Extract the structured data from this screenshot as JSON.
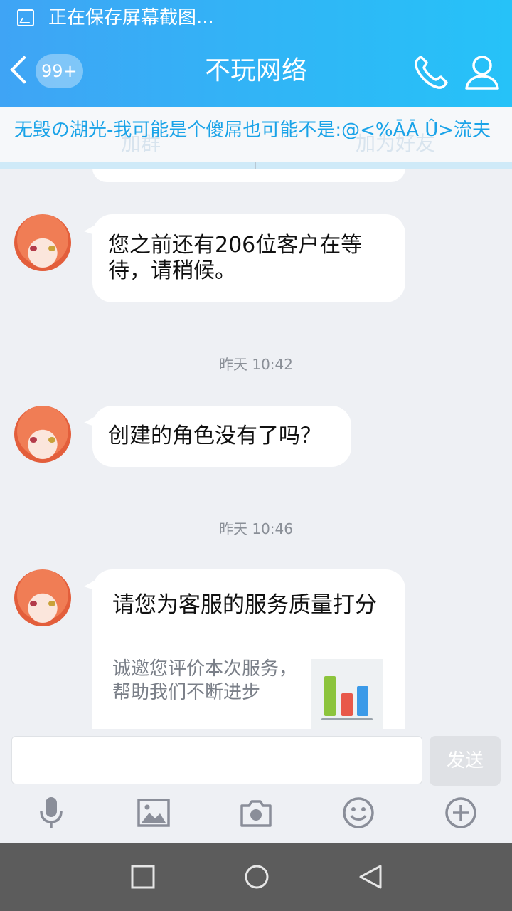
{
  "status": {
    "text": "正在保存屏幕截图..."
  },
  "header": {
    "unread_badge": "99+",
    "title": "不玩网络"
  },
  "notice": {
    "text": "无毁の湖光-我可能是个傻屌也可能不是:@<%ĀĀ Û>流夫",
    "ghost_left": "加群",
    "ghost_right": "加为好友"
  },
  "messages": [
    {
      "type": "text",
      "text": "您之前还有206位客户在等待，请稍候。"
    },
    {
      "type": "time",
      "text": "昨天 10:42"
    },
    {
      "type": "text",
      "text": "创建的角色没有了吗？"
    },
    {
      "type": "time",
      "text": "昨天 10:46"
    },
    {
      "type": "card",
      "title": "请您为客服的服务质量打分",
      "desc": "诚邀您评价本次服务，帮助我们不断进步"
    }
  ],
  "input": {
    "send_label": "发送"
  },
  "colors": {
    "accent": "#1aa3e8",
    "header_start": "#3fa4f5",
    "header_end": "#26c2f8"
  },
  "icons": [
    "status-image-icon",
    "back-chevron-icon",
    "phone-icon",
    "person-icon",
    "microphone-icon",
    "image-icon",
    "camera-icon",
    "emoji-icon",
    "plus-icon",
    "nav-square-icon",
    "nav-circle-icon",
    "nav-triangle-icon"
  ]
}
